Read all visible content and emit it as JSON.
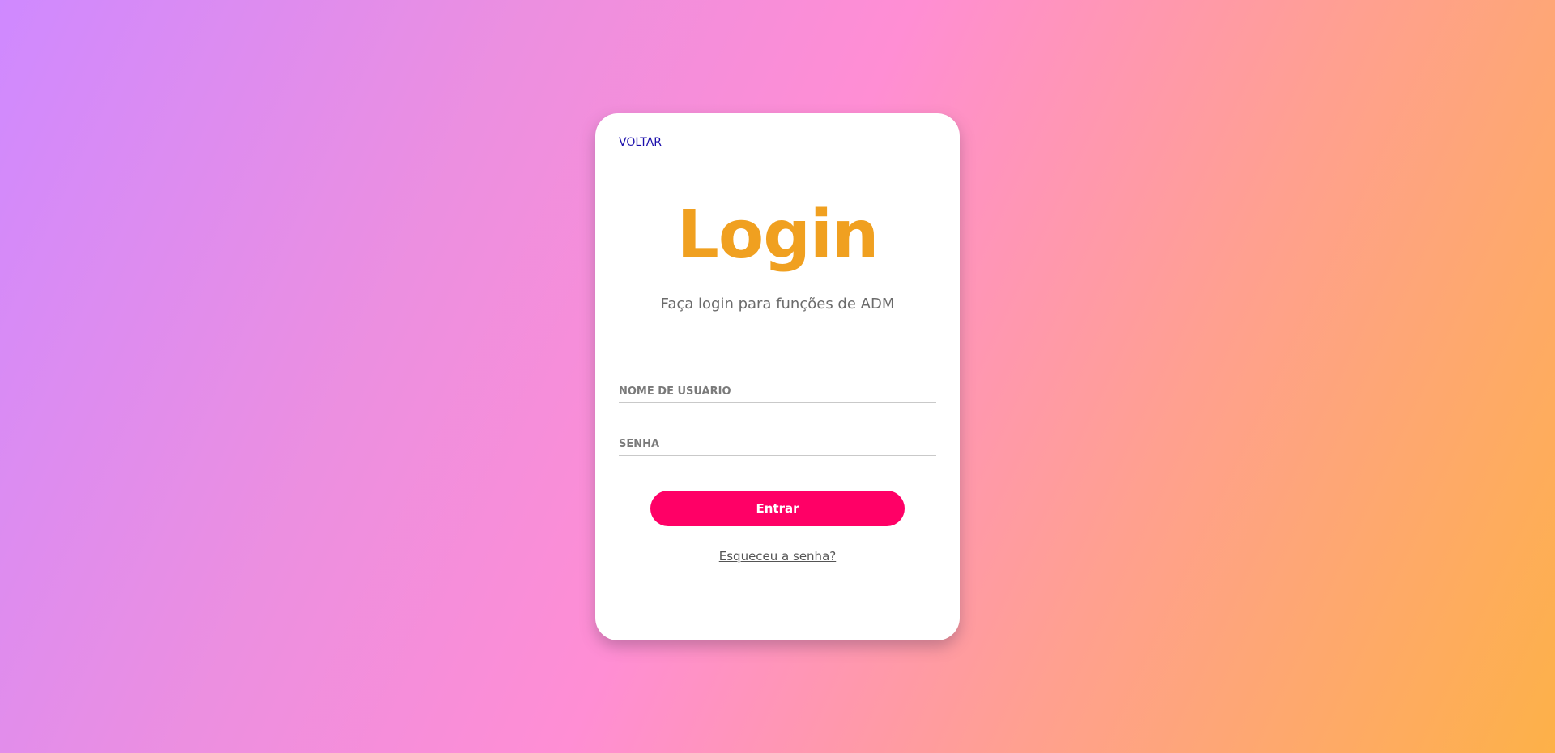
{
  "nav": {
    "back_label": "VOLTAR"
  },
  "login": {
    "title": "Login",
    "subtitle": "Faça login para funções de ADM",
    "username_placeholder": "NOME DE USUÁRIO",
    "password_placeholder": "SENHA",
    "submit_label": "Entrar",
    "forgot_label": "Esqueceu a senha?"
  },
  "colors": {
    "title": "#f0a020",
    "button": "#ff0066",
    "link": "#1a0dab",
    "gradient_start": "#cf89ff",
    "gradient_mid": "#ff8ed4",
    "gradient_end": "#fdb148"
  }
}
